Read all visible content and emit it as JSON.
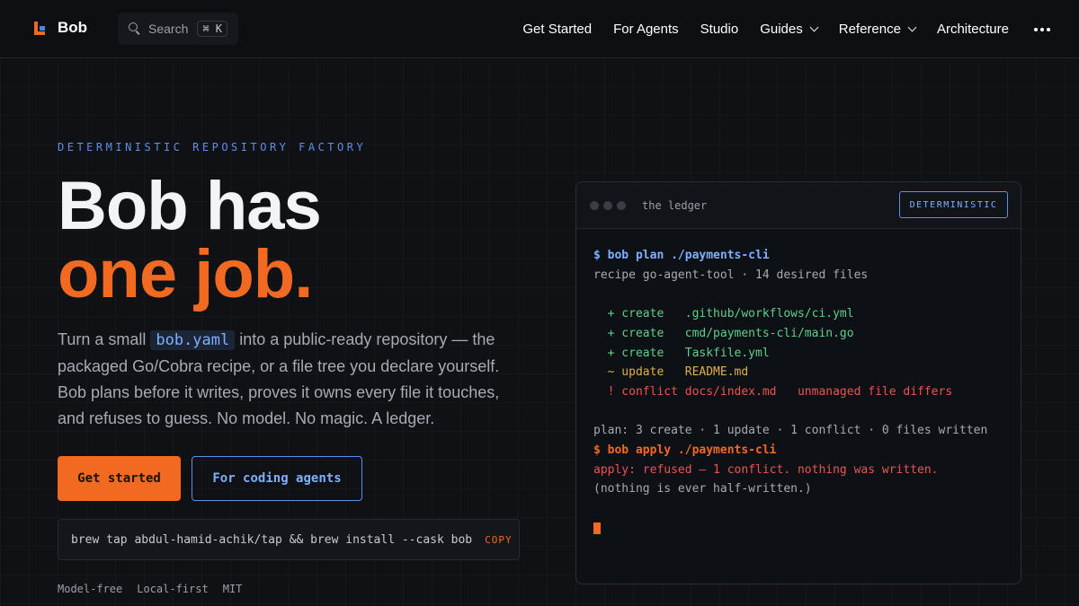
{
  "nav": {
    "brand": "Bob",
    "search_label": "Search",
    "search_shortcut": "⌘ K",
    "links": [
      {
        "label": "Get Started"
      },
      {
        "label": "For Agents"
      },
      {
        "label": "Studio"
      },
      {
        "label": "Guides"
      },
      {
        "label": "Reference"
      },
      {
        "label": "Architecture"
      }
    ]
  },
  "hero": {
    "eyebrow": "DETERMINISTIC REPOSITORY FACTORY",
    "title_line1": "Bob has",
    "title_line2": "one job.",
    "lede_pre": "Turn a small ",
    "lede_code": "bob.yaml",
    "lede_post": " into a public-ready repository — the packaged Go/Cobra recipe, or a file tree you declare yourself. Bob plans before it writes, proves it owns every file it touches, and refuses to guess. No model. No magic. A ledger.",
    "primary_button": "Get started",
    "secondary_button": "For coding agents",
    "install_cmd": "brew tap abdul-hamid-achik/tap && brew install --cask bob",
    "copy_label": "COPY",
    "tags": [
      "Model-free",
      "Local-first",
      "MIT"
    ]
  },
  "terminal": {
    "title": "the ledger",
    "badge": "DETERMINISTIC",
    "cmd_plan": "$ bob plan ./payments-cli",
    "plan_summary": "recipe go-agent-tool · 14 desired files",
    "ops": [
      {
        "text": "  + create   .github/workflows/ci.yml",
        "kind": "create"
      },
      {
        "text": "  + create   cmd/payments-cli/main.go",
        "kind": "create"
      },
      {
        "text": "  + create   Taskfile.yml",
        "kind": "create"
      },
      {
        "text": "  ~ update   README.md",
        "kind": "update"
      },
      {
        "text": "  ! conflict docs/index.md   unmanaged file differs",
        "kind": "conflict"
      }
    ],
    "plan_result": "plan: 3 create · 1 update · 1 conflict · 0 files written",
    "cmd_apply": "$ bob apply ./payments-cli",
    "apply_result": "apply: refused — 1 conflict. nothing was written.",
    "footnote": "(nothing is ever half-written.)"
  },
  "colors": {
    "accent_orange": "#f26a21",
    "accent_blue": "#5b8fe8",
    "create_green": "#5fd08a",
    "update_yellow": "#e0b04a",
    "conflict_red": "#ef5350"
  }
}
